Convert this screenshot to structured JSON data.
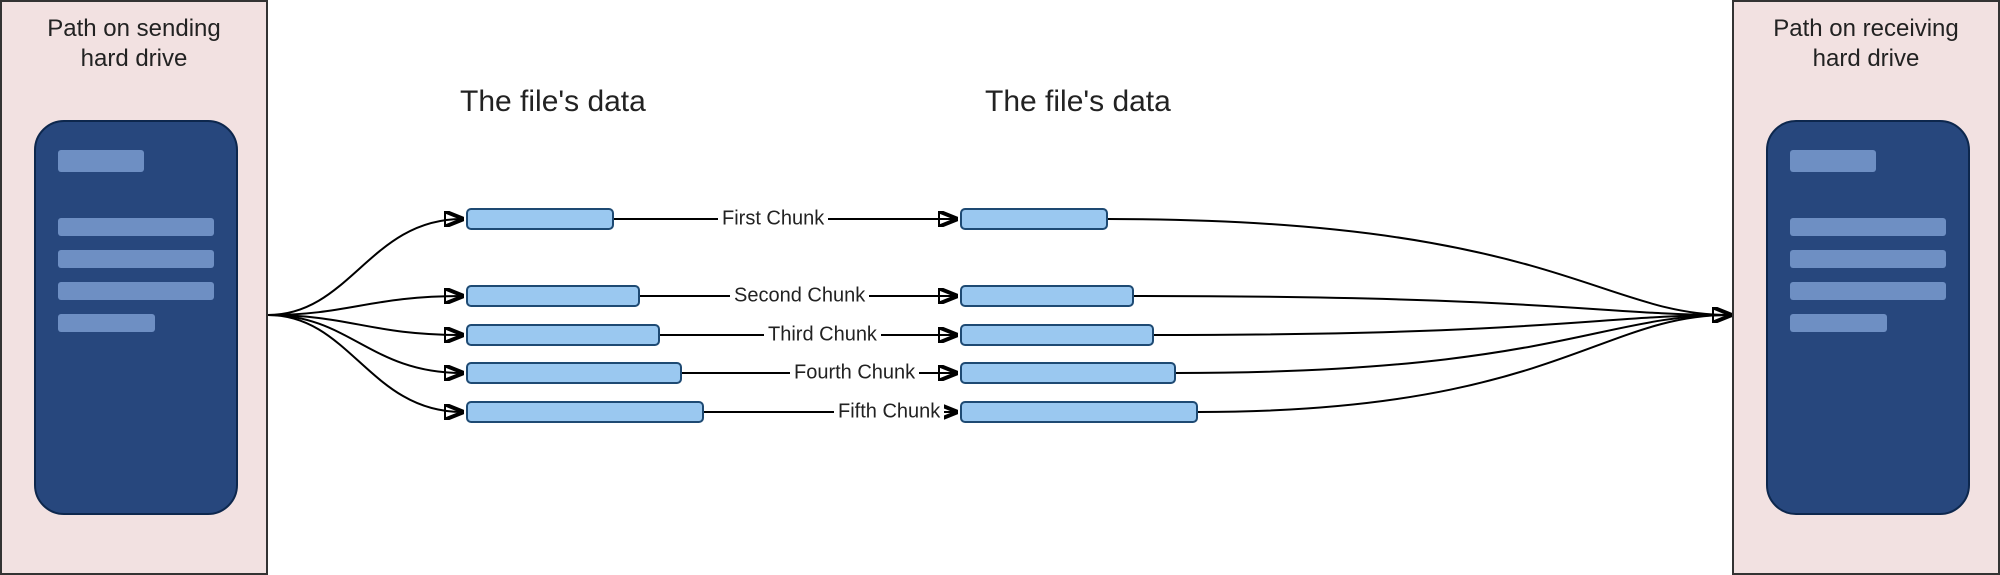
{
  "panels": {
    "left": {
      "title_line1": "Path on sending",
      "title_line2": "hard drive"
    },
    "right": {
      "title_line1": "Path on receiving",
      "title_line2": "hard drive"
    }
  },
  "headings": {
    "left": "The file's data",
    "right": "The file's data"
  },
  "chunks": {
    "c1": {
      "label": "First Chunk"
    },
    "c2": {
      "label": "Second Chunk"
    },
    "c3": {
      "label": "Third Chunk"
    },
    "c4": {
      "label": "Fourth Chunk"
    },
    "c5": {
      "label": "Fifth Chunk"
    }
  },
  "chart_data": {
    "type": "diagram",
    "title": "File data transferred as chunks between drives",
    "source": "Path on sending hard drive",
    "destination": "Path on receiving hard drive",
    "node_label": "The file's data",
    "chunks": [
      "First Chunk",
      "Second Chunk",
      "Third Chunk",
      "Fourth Chunk",
      "Fifth Chunk"
    ],
    "flow": "source → split into chunks (left column) → each chunk → right column → merge → destination"
  }
}
